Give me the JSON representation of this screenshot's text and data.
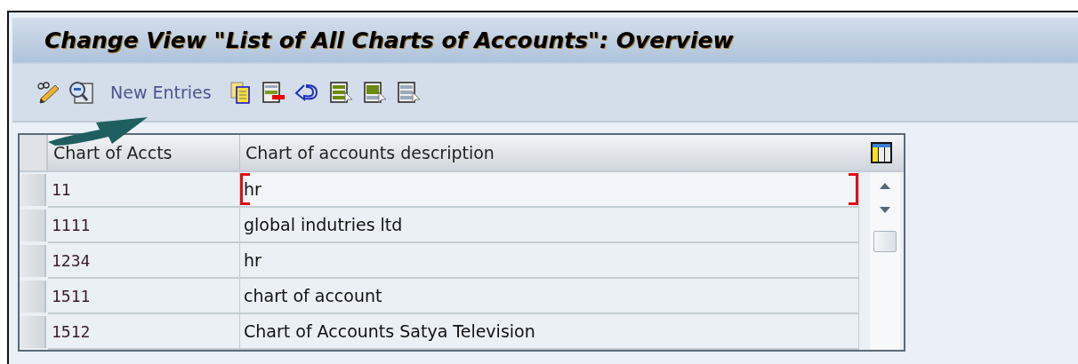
{
  "window": {
    "title": "Change View \"List of All Charts of Accounts\": Overview"
  },
  "toolbar": {
    "new_entries": "New Entries"
  },
  "table": {
    "columns": [
      "Chart of Accts",
      "Chart of accounts description"
    ],
    "rows": [
      {
        "cells": [
          "11",
          "hr"
        ],
        "focused": true
      },
      {
        "cells": [
          "1111",
          "global indutries ltd"
        ],
        "focused": false
      },
      {
        "cells": [
          "1234",
          "hr"
        ],
        "focused": false
      },
      {
        "cells": [
          "1511",
          "chart of account"
        ],
        "focused": false
      },
      {
        "cells": [
          "1512",
          "Chart of Accounts Satya Television"
        ],
        "focused": false
      }
    ]
  }
}
